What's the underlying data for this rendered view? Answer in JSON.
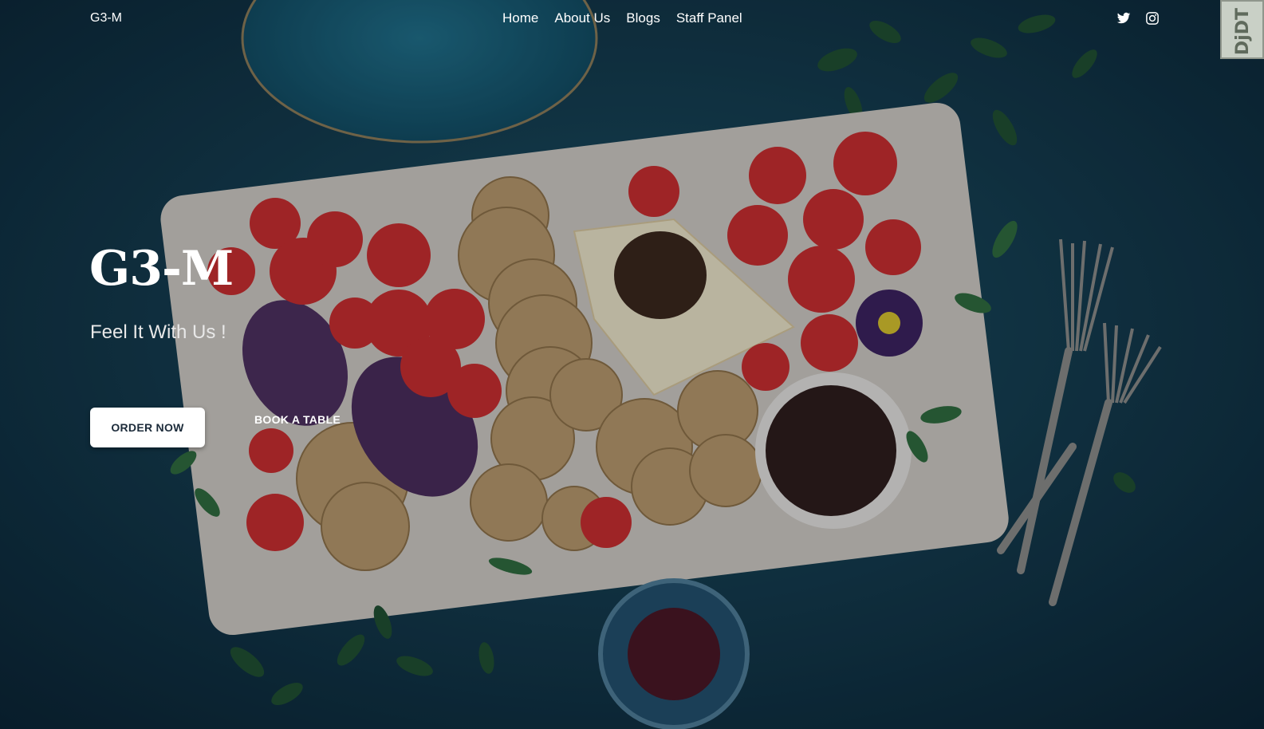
{
  "navbar": {
    "brand": "G3-M",
    "links": [
      {
        "label": "Home"
      },
      {
        "label": "About Us"
      },
      {
        "label": "Blogs"
      },
      {
        "label": "Staff Panel"
      }
    ],
    "social_icons": [
      "twitter-icon",
      "instagram-icon"
    ]
  },
  "devtool": {
    "label": "DjDT"
  },
  "hero": {
    "title": "G3-M",
    "subtitle": "Feel It With Us !",
    "order_button": "ORDER NOW",
    "book_button": "BOOK A TABLE"
  },
  "colors": {
    "background": "#0f2a36",
    "text": "#ffffff",
    "button_bg": "#ffffff",
    "button_text": "#1c2b3a"
  }
}
